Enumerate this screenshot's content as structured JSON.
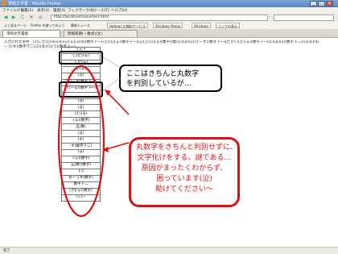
{
  "window": {
    "title": "単純文字置 - Mozilla Firefox",
    "min": "_",
    "max": "□",
    "close": "×"
  },
  "menu": [
    "ファイル(F)",
    "編集(E)",
    "表示(V)",
    "履歴(S)",
    "ブックマーク(B)",
    "ツール(T)",
    "ヘルプ(H)"
  ],
  "nav": {
    "url": "http://localhost/sano/test.html",
    "back": "◀",
    "forward": "▶",
    "reload": "C",
    "stop": "✕",
    "home": "⌂"
  },
  "bookmarks": [
    "よく見るページ",
    "Firefox を使ってみよう",
    "最新ニュース",
    "Hotmail の無料サービス",
    "Windows Media",
    "Windows",
    "リンクの表示"
  ],
  "tabs": [
    "単純文字置換",
    "移植移題(・数式)(文)"
  ],
  "content": {
    "input_line1": "入力された条件　(1)した(1)(あ)(あ)(1)(る)(3)(8)(数字下一)(さ)(1)(る)(数字下一)(1)(さ)(1)(る)(数字)(数)(1)(あ)(2)(えーす)(数字下一)(た)(り)(さ)(る)(数字下一)(1)(あ)(2)(数字下二)(1)(あ)(4)",
    "input_line2": "ーう(す)(数字下二)(2)(あ)(1)(う)(数字上ー)",
    "list": [
      "リスト",
      "し(た)(る)",
      "した(る)",
      "た(る)",
      "(る)",
      "(ぎ)ーす(数字下一)",
      "ぎ(ーる)(数字下一)",
      "",
      "(る)",
      "(る)",
      "(え)(る)",
      "-(る)(数字)",
      "五(数)",
      "(る)",
      "(す)",
      "-す(数字下二)",
      "(る)",
      "-(る)(数字)",
      "五(数)(数字)",
      "下ニ",
      "おーうす(数字)",
      "数字下二",
      "(ク)(る)(数字)",
      "(シ)ー"
    ]
  },
  "callout1": {
    "line1": "ここはきちんと丸数字",
    "line2": "を判別しているが…"
  },
  "callout2": {
    "line1": "丸数字をきちんと判別せずに、",
    "line2": "文字化けをする。謎である…",
    "line3": "原因がまったくわからず、",
    "line4": "困っています(泣)",
    "line5": "助けてください～"
  },
  "status": "完了",
  "colors": {
    "titlebar": "#5a84c2",
    "callout_red": "#dd1111"
  }
}
